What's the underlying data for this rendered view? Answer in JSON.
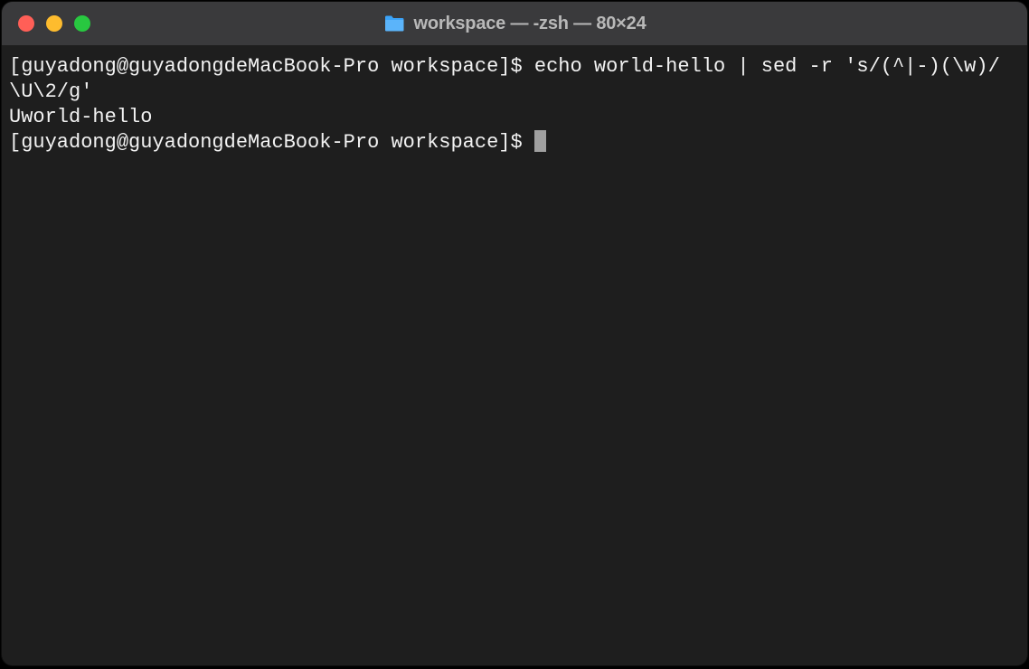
{
  "window": {
    "title": "workspace — -zsh — 80×24"
  },
  "terminal": {
    "lines": [
      {
        "prompt": "[guyadong@guyadongdeMacBook-Pro workspace]$ ",
        "command": "echo world-hello | sed -r 's/(^|-)(\\w)/\\U\\2/g'"
      },
      {
        "output": "Uworld-hello"
      },
      {
        "prompt": "[guyadong@guyadongdeMacBook-Pro workspace]$ ",
        "command": "",
        "cursor": true
      }
    ]
  }
}
